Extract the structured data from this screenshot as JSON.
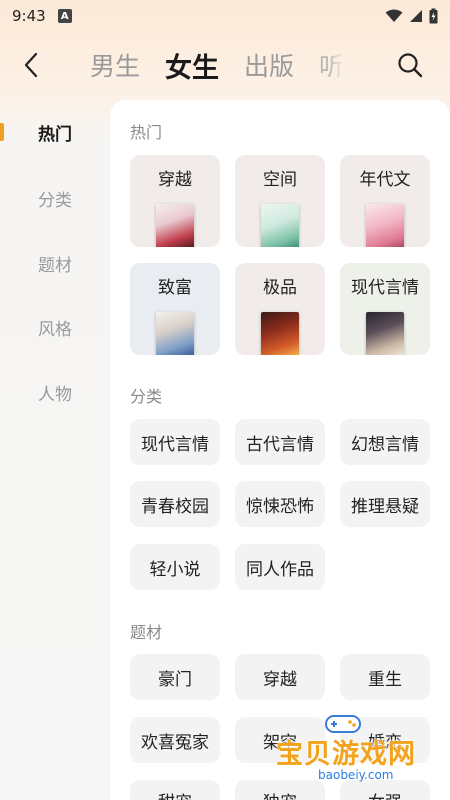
{
  "status_bar": {
    "time": "9:43",
    "badge": "A"
  },
  "nav": {
    "tabs": [
      {
        "label": "男生"
      },
      {
        "label": "女生"
      },
      {
        "label": "出版"
      },
      {
        "label": "听"
      }
    ],
    "active_tab": "女生"
  },
  "sidebar": {
    "items": [
      {
        "label": "热门"
      },
      {
        "label": "分类"
      },
      {
        "label": "题材"
      },
      {
        "label": "风格"
      },
      {
        "label": "人物"
      }
    ],
    "active": "热门",
    "accent_color": "#f0a020"
  },
  "hot": {
    "title": "热门",
    "cards": [
      {
        "label": "穿越"
      },
      {
        "label": "空间"
      },
      {
        "label": "年代文"
      },
      {
        "label": "致富"
      },
      {
        "label": "极品"
      },
      {
        "label": "现代言情"
      }
    ]
  },
  "category": {
    "title": "分类",
    "chips": [
      {
        "label": "现代言情"
      },
      {
        "label": "古代言情"
      },
      {
        "label": "幻想言情"
      },
      {
        "label": "青春校园"
      },
      {
        "label": "惊悚恐怖"
      },
      {
        "label": "推理悬疑"
      },
      {
        "label": "轻小说"
      },
      {
        "label": "同人作品"
      }
    ]
  },
  "theme": {
    "title": "题材",
    "chips": [
      {
        "label": "豪门"
      },
      {
        "label": "穿越"
      },
      {
        "label": "重生"
      },
      {
        "label": "欢喜冤家"
      },
      {
        "label": "架空"
      },
      {
        "label": "婚恋"
      },
      {
        "label": "甜宠"
      },
      {
        "label": "独宠"
      },
      {
        "label": "女强"
      }
    ]
  },
  "watermark": {
    "text": "宝贝游戏网",
    "url": "baobeiy.com"
  }
}
